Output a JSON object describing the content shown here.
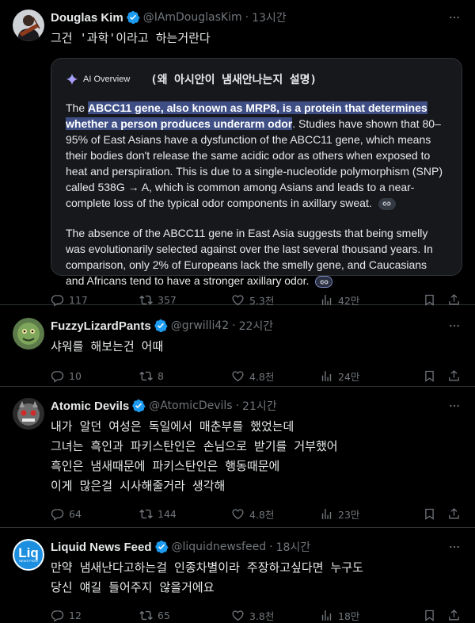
{
  "tweets": [
    {
      "name": "Douglas Kim",
      "handle": "@IAmDouglasKim",
      "time": "13시간",
      "text": "그건 '과학'이라고 하는거란다",
      "ai": {
        "label": "AI Overview",
        "note": "(왜 아시안이 냄새안나는지 설명)",
        "p1_pre": "The ",
        "p1_hl": "ABCC11 gene, also known as MRP8, is a protein that determines whether a person produces underarm odor",
        "p1_post": ". Studies have shown that 80–95% of East Asians have a dysfunction of the ABCC11 gene, which means their bodies don't release the same acidic odor as others when exposed to heat and perspiration. This is due to a single-nucleotide polymorphism (SNP) called 538G → A, which is common among Asians and leads to a near-complete loss of the typical odor components in axillary sweat.",
        "p2": "The absence of the ABCC11 gene in East Asia suggests that being smelly was evolutionarily selected against over the last several thousand years. In comparison, only 2% of Europeans lack the smelly gene, and Caucasians and Africans tend to have a stronger axillary odor."
      },
      "replies": "117",
      "reposts": "357",
      "likes": "5.3천",
      "views": "42만"
    },
    {
      "name": "FuzzyLizardPants",
      "handle": "@grwilli42",
      "time": "22시간",
      "text": "샤워를 해보는건 어때",
      "replies": "10",
      "reposts": "8",
      "likes": "4.8천",
      "views": "24만"
    },
    {
      "name": "Atomic Devils",
      "handle": "@AtomicDevils",
      "time": "21시간",
      "text": "내가 알던 여성은 독일에서 매춘부를 했었는데\n그녀는 흑인과 파키스탄인은 손님으로 받기를 거부했어\n흑인은 냄새때문에 파키스탄인은 행동때문에\n이게 많은걸 시사해줄거라 생각해",
      "replies": "64",
      "reposts": "144",
      "likes": "4.8천",
      "views": "23만"
    },
    {
      "name": "Liquid News Feed",
      "handle": "@liquidnewsfeed",
      "time": "18시간",
      "avatar_text": "Liq",
      "avatar_sub": "NEWS FEED",
      "text": "만약 냄새난다고하는걸 인종차별이라 주장하고싶다면 누구도\n당신 얘길 들어주지 않을거에요",
      "replies": "12",
      "reposts": "65",
      "likes": "3.8천",
      "views": "18만"
    }
  ],
  "colors": {
    "bg": "#000000",
    "text": "#e7e9ea",
    "muted": "#71767b",
    "verified": "#1d9bf0",
    "divider": "#2f3336",
    "highlight": "#3f4f86"
  }
}
